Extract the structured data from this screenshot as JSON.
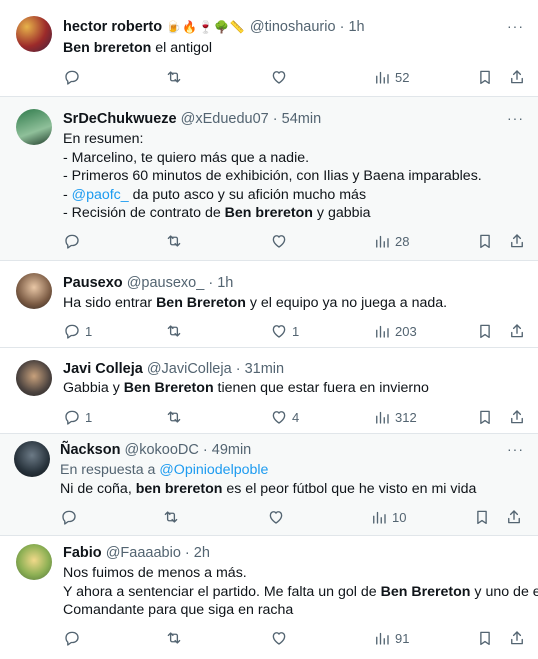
{
  "tweets": [
    {
      "name": "hector roberto",
      "name_emoji": "🍺🔥🍷🌳📏",
      "handle": "@tinoshaurio",
      "time": "1h",
      "reply_to": null,
      "lines": [
        [
          {
            "t": "Ben brereton",
            "s": "hl"
          },
          {
            "t": " el antigol"
          }
        ]
      ],
      "stats": {
        "replies": "",
        "retweets": "",
        "likes": "",
        "views": "52"
      }
    },
    {
      "name": "SrDeChukwueze",
      "handle": "@xEduedu07",
      "time": "54min",
      "reply_to": null,
      "lines": [
        [
          {
            "t": "En resumen:"
          }
        ],
        [
          {
            "t": "- Marcelino, te quiero más que a nadie."
          }
        ],
        [
          {
            "t": "- Primeros 60 minutos de exhibición, con Ilias y Baena imparables."
          }
        ],
        [
          {
            "t": "- "
          },
          {
            "t": "@paofc_",
            "s": "mention"
          },
          {
            "t": " da puto asco y su afición mucho más"
          }
        ],
        [
          {
            "t": "- Recisión de contrato de "
          },
          {
            "t": "Ben brereton",
            "s": "hl"
          },
          {
            "t": " y gabbia"
          }
        ]
      ],
      "stats": {
        "replies": "",
        "retweets": "",
        "likes": "",
        "views": "28"
      }
    },
    {
      "name": "Pausexo",
      "handle": "@pausexo_",
      "time": "1h",
      "reply_to": null,
      "lines": [
        [
          {
            "t": "Ha sido entrar "
          },
          {
            "t": "Ben Brereton",
            "s": "hl"
          },
          {
            "t": " y el equipo ya no juega a nada."
          }
        ]
      ],
      "stats": {
        "replies": "1",
        "retweets": "",
        "likes": "1",
        "views": "203"
      }
    },
    {
      "name": "Javi Colleja",
      "handle": "@JaviColleja",
      "time": "31min",
      "reply_to": null,
      "lines": [
        [
          {
            "t": "Gabbia y "
          },
          {
            "t": "Ben Brereton",
            "s": "hl"
          },
          {
            "t": " tienen que estar fuera en invierno"
          }
        ]
      ],
      "stats": {
        "replies": "1",
        "retweets": "",
        "likes": "4",
        "views": "312"
      }
    },
    {
      "name": "Ñackson",
      "handle": "@kokooDC",
      "time": "49min",
      "reply_to": {
        "prefix": "En respuesta a ",
        "user": "@Opiniodelpoble"
      },
      "lines": [
        [
          {
            "t": "Ni de coña, "
          },
          {
            "t": "ben brereton",
            "s": "hl"
          },
          {
            "t": " es el peor fútbol que he visto en mi vida"
          }
        ]
      ],
      "stats": {
        "replies": "",
        "retweets": "",
        "likes": "",
        "views": "10"
      }
    },
    {
      "name": "Fabio",
      "handle": "@Faaaabio",
      "time": "2h",
      "reply_to": null,
      "lines": [
        [
          {
            "t": "Nos fuimos de menos a más."
          }
        ],
        [
          {
            "t": "Y ahora a sentenciar el partido. Me falta un gol de "
          },
          {
            "t": "Ben Brereton",
            "s": "hl"
          },
          {
            "t": " y uno de el"
          }
        ],
        [
          {
            "t": "Comandante para que siga en racha"
          }
        ]
      ],
      "stats": {
        "replies": "",
        "retweets": "",
        "likes": "",
        "views": "91"
      }
    }
  ],
  "separator": "·",
  "more_glyph": "···",
  "colors": {
    "link": "#1d9bf0",
    "muted": "#536471",
    "text": "#0f1419",
    "border": "#e1e6ea"
  }
}
